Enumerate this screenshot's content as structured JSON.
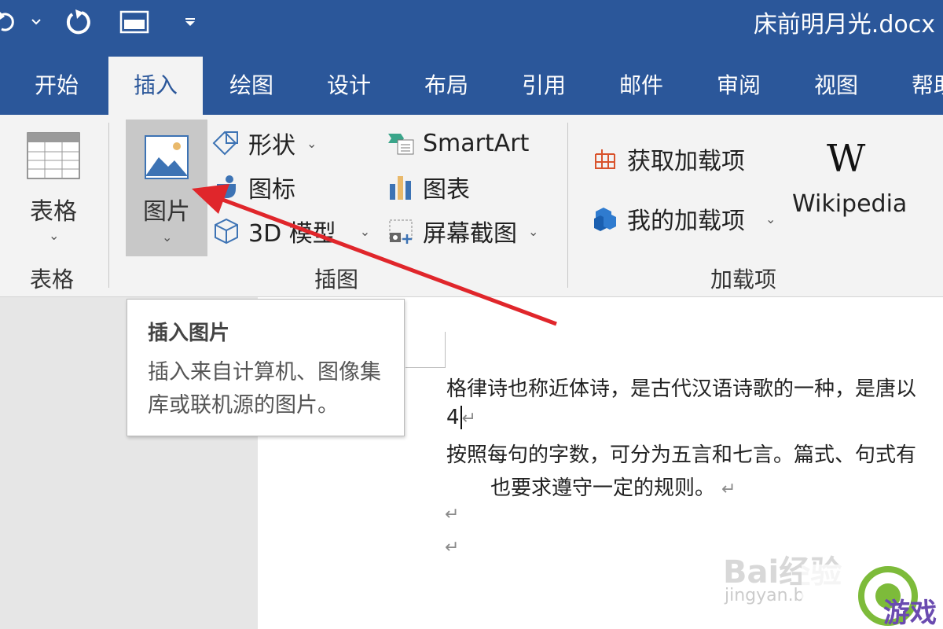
{
  "title_bar": {
    "doc_title": "床前明月光.docx",
    "background": "#2b579a",
    "quick_access": [
      "undo-icon",
      "undo-dropdown-icon",
      "redo-icon",
      "window-icon",
      "customize-dropdown-icon"
    ]
  },
  "tabs": [
    {
      "label": "开始",
      "active": false
    },
    {
      "label": "插入",
      "active": true
    },
    {
      "label": "绘图",
      "active": false
    },
    {
      "label": "设计",
      "active": false
    },
    {
      "label": "布局",
      "active": false
    },
    {
      "label": "引用",
      "active": false
    },
    {
      "label": "邮件",
      "active": false
    },
    {
      "label": "审阅",
      "active": false
    },
    {
      "label": "视图",
      "active": false
    },
    {
      "label": "帮助",
      "active": false
    }
  ],
  "ribbon": {
    "table_group": {
      "button_label": "表格",
      "group_label": "表格"
    },
    "illustrations_group": {
      "picture_label": "图片",
      "shapes_label": "形状",
      "icons_label": "图标",
      "model3d_label": "3D 模型",
      "smartart_label": "SmartArt",
      "chart_label": "图表",
      "screenshot_label": "屏幕截图",
      "group_label": "插图"
    },
    "addins_group": {
      "get_addins_label": "获取加载项",
      "my_addins_label": "我的加载项",
      "wikipedia_label": "Wikipedia",
      "wikipedia_logo": "W",
      "group_label": "加载项"
    }
  },
  "tooltip": {
    "title": "插入图片",
    "description": "插入来自计算机、图像集库或联机源的图片。"
  },
  "document": {
    "lines": [
      "格律诗也称近体诗，是古代汉语诗歌的一种，是唐以",
      "4",
      "按照每句的字数，可分为五言和七言。篇式、句式有",
      "也要求遵守一定的规则。"
    ],
    "paragraph_mark": "↵"
  },
  "watermarks": {
    "baidu": "Bai经验",
    "jingyan": "jingyan.b",
    "game": "游戏"
  },
  "colors": {
    "accent": "#2b579a",
    "arrow": "#e0262b",
    "ribbon_bg": "#f3f3f3"
  }
}
